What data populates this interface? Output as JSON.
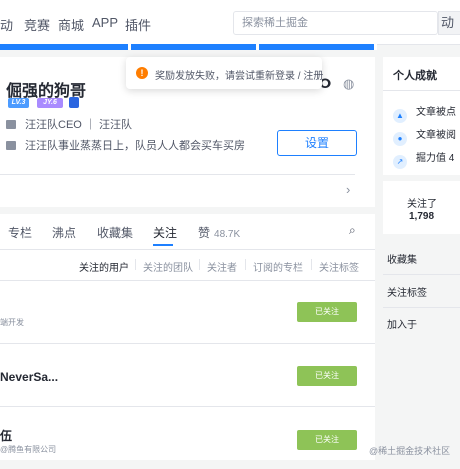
{
  "topnav": {
    "items": [
      "动",
      "竞赛",
      "商城",
      "APP",
      "插件"
    ],
    "search_placeholder": "探索稀土掘金",
    "search_button": "动"
  },
  "toast": {
    "icon": "warning-icon",
    "message": "奖励发放失败，请尝试重新登录 / 注册"
  },
  "profile": {
    "username": "倔强的狗哥",
    "badges": [
      "LV.3",
      "JY.6"
    ],
    "position": "汪汪队CEO ｜ 汪汪队",
    "bio": "汪汪队事业蒸蒸日上，队员人人都会买车买房",
    "settings_button": "设置"
  },
  "tabs": {
    "items": [
      "专栏",
      "沸点",
      "收藏集",
      "关注",
      "赞"
    ],
    "like_count": "48.7K",
    "active": "关注"
  },
  "sub_tabs": [
    "关注的用户",
    "关注的团队",
    "关注者",
    "订阅的专栏",
    "关注标签"
  ],
  "users": [
    {
      "name": "",
      "desc": "端开发",
      "button": "已关注"
    },
    {
      "name": "NeverSa...",
      "desc": "",
      "button": "已关注"
    },
    {
      "name": "伍",
      "desc": "@腾鱼有限公司",
      "button": "已关注"
    }
  ],
  "sidebar": {
    "title": "个人成就",
    "stats": [
      {
        "icon": "thumb-up-icon",
        "label": "文章被点"
      },
      {
        "icon": "eye-icon",
        "label": "文章被阅"
      },
      {
        "icon": "chart-icon",
        "label": "掘力值 4"
      }
    ],
    "following_label": "关注了",
    "following_count": "1,798",
    "links": [
      "收藏集",
      "关注标签",
      "加入于"
    ]
  },
  "watermark": "@稀土掘金技术社区",
  "colors": {
    "accent": "#1e80ff",
    "followed": "#8ec357",
    "toast_warning": "#ff7d00"
  }
}
